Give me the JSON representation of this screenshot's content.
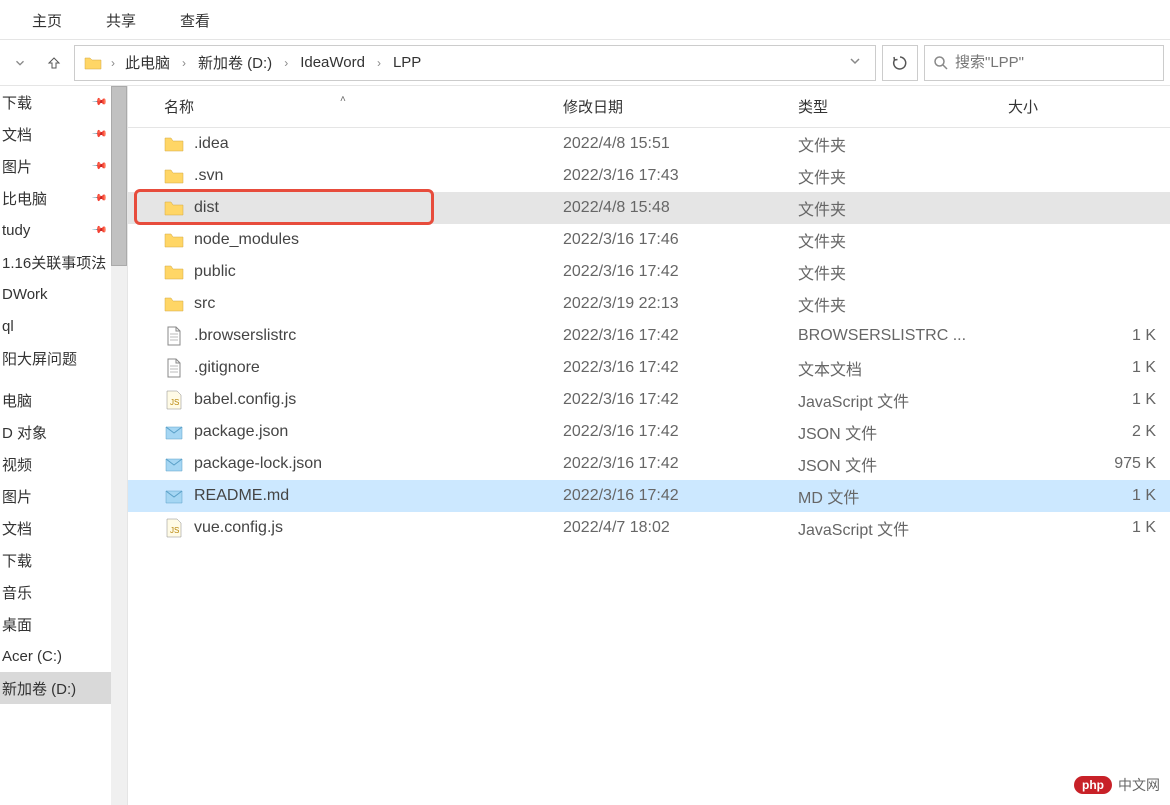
{
  "tabs": [
    "主页",
    "共享",
    "查看"
  ],
  "breadcrumb": [
    "此电脑",
    "新加卷 (D:)",
    "IdeaWord",
    "LPP"
  ],
  "search_placeholder": "搜索\"LPP\"",
  "columns": {
    "name": "名称",
    "date": "修改日期",
    "type": "类型",
    "size": "大小"
  },
  "sidebar_items": [
    {
      "label": "下载",
      "pinned": true
    },
    {
      "label": "文档",
      "pinned": true
    },
    {
      "label": "图片",
      "pinned": true
    },
    {
      "label": "比电脑",
      "pinned": true
    },
    {
      "label": "tudy",
      "pinned": true
    },
    {
      "label": "1.16关联事项法"
    },
    {
      "label": "DWork"
    },
    {
      "label": "ql"
    },
    {
      "label": "阳大屏问题"
    },
    {
      "spacer": true
    },
    {
      "label": "电脑"
    },
    {
      "label": "D 对象"
    },
    {
      "label": "视频"
    },
    {
      "label": "图片"
    },
    {
      "label": "文档"
    },
    {
      "label": "下载"
    },
    {
      "label": "音乐"
    },
    {
      "label": "桌面"
    },
    {
      "label": "Acer (C:)"
    },
    {
      "label": "新加卷 (D:)",
      "selected": true
    }
  ],
  "files": [
    {
      "icon": "folder",
      "name": ".idea",
      "date": "2022/4/8 15:51",
      "type": "文件夹",
      "size": ""
    },
    {
      "icon": "folder",
      "name": ".svn",
      "date": "2022/3/16 17:43",
      "type": "文件夹",
      "size": ""
    },
    {
      "icon": "folder",
      "name": "dist",
      "date": "2022/4/8 15:48",
      "type": "文件夹",
      "size": "",
      "highlighted": true
    },
    {
      "icon": "folder",
      "name": "node_modules",
      "date": "2022/3/16 17:46",
      "type": "文件夹",
      "size": ""
    },
    {
      "icon": "folder",
      "name": "public",
      "date": "2022/3/16 17:42",
      "type": "文件夹",
      "size": ""
    },
    {
      "icon": "folder",
      "name": "src",
      "date": "2022/3/19 22:13",
      "type": "文件夹",
      "size": ""
    },
    {
      "icon": "textfile",
      "name": ".browserslistrc",
      "date": "2022/3/16 17:42",
      "type": "BROWSERSLISTRC ...",
      "size": "1 K"
    },
    {
      "icon": "textfile",
      "name": ".gitignore",
      "date": "2022/3/16 17:42",
      "type": "文本文档",
      "size": "1 K"
    },
    {
      "icon": "jsfile",
      "name": "babel.config.js",
      "date": "2022/3/16 17:42",
      "type": "JavaScript 文件",
      "size": "1 K"
    },
    {
      "icon": "jsonfile",
      "name": "package.json",
      "date": "2022/3/16 17:42",
      "type": "JSON 文件",
      "size": "2 K"
    },
    {
      "icon": "jsonfile",
      "name": "package-lock.json",
      "date": "2022/3/16 17:42",
      "type": "JSON 文件",
      "size": "975 K"
    },
    {
      "icon": "jsonfile",
      "name": "README.md",
      "date": "2022/3/16 17:42",
      "type": "MD 文件",
      "size": "1 K",
      "selected": true
    },
    {
      "icon": "jsfile",
      "name": "vue.config.js",
      "date": "2022/4/7 18:02",
      "type": "JavaScript 文件",
      "size": "1 K"
    }
  ],
  "watermark": {
    "badge": "php",
    "text": "中文网"
  }
}
